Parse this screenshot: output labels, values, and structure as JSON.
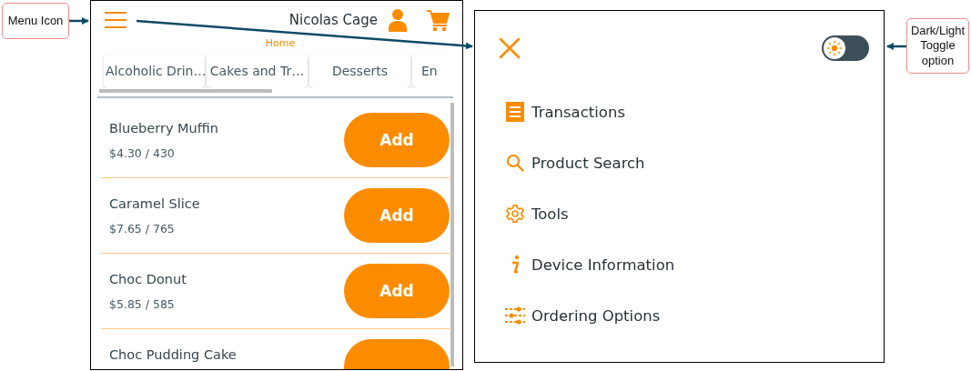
{
  "callouts": [
    {
      "text": "Menu Icon"
    },
    {
      "text": "Dark/Light Toggle option"
    }
  ],
  "home_screen": {
    "user_name": "Nicolas Cage",
    "page_title": "Home",
    "categories": [
      {
        "label": "Alcoholic Drin…",
        "selected": false
      },
      {
        "label": "Cakes and Tr…",
        "selected": false
      },
      {
        "label": "Desserts",
        "selected": false
      },
      {
        "label": "En",
        "selected": false
      }
    ],
    "products": [
      {
        "name": "Blueberry Muffin",
        "price": "$4.30 / 430",
        "button": "Add"
      },
      {
        "name": "Caramel Slice",
        "price": "$7.65 / 765",
        "button": "Add"
      },
      {
        "name": "Choc Donut",
        "price": "$5.85 / 585",
        "button": "Add"
      },
      {
        "name": "Choc Pudding Cake"
      }
    ]
  },
  "menu_screen": {
    "theme_toggle": {
      "on": false
    },
    "items": [
      {
        "label": "Transactions"
      },
      {
        "label": "Product Search"
      },
      {
        "label": "Tools"
      },
      {
        "label": "Device Information"
      },
      {
        "label": "Ordering Options"
      }
    ]
  }
}
